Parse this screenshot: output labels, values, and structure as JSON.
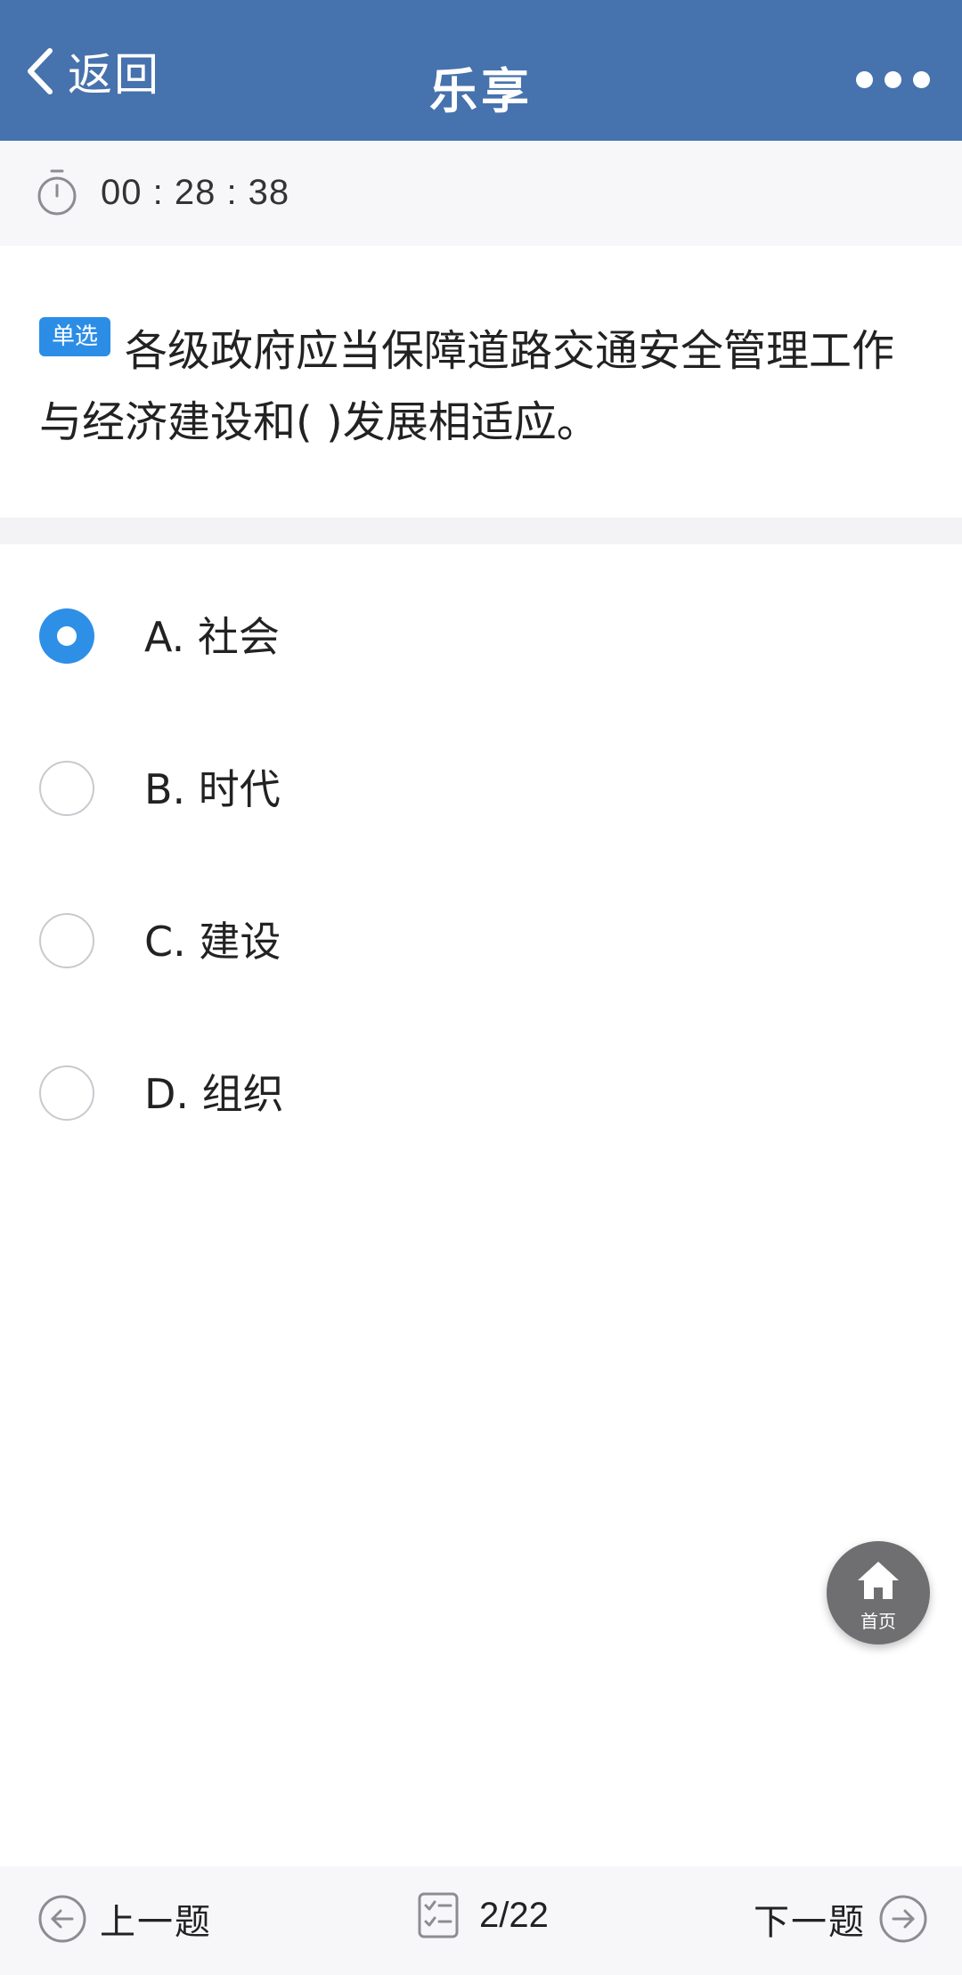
{
  "header": {
    "back_label": "返回",
    "title": "乐享",
    "background": "#4672ad"
  },
  "timer": {
    "icon": "stopwatch-icon",
    "value": "00 : 28 : 38"
  },
  "question": {
    "type_badge": "单选",
    "text": "各级政府应当保障道路交通安全管理工作与经济建设和( )发展相适应。"
  },
  "options": [
    {
      "label": "A. 社会",
      "selected": true
    },
    {
      "label": "B. 时代",
      "selected": false
    },
    {
      "label": "C. 建设",
      "selected": false
    },
    {
      "label": "D. 组织",
      "selected": false
    }
  ],
  "home_button": {
    "label": "首页",
    "icon": "home-icon"
  },
  "bottom_nav": {
    "prev_label": "上一题",
    "progress": "2/22",
    "next_label": "下一题"
  },
  "colors": {
    "accent": "#2e8fe6",
    "header": "#4672ad"
  }
}
